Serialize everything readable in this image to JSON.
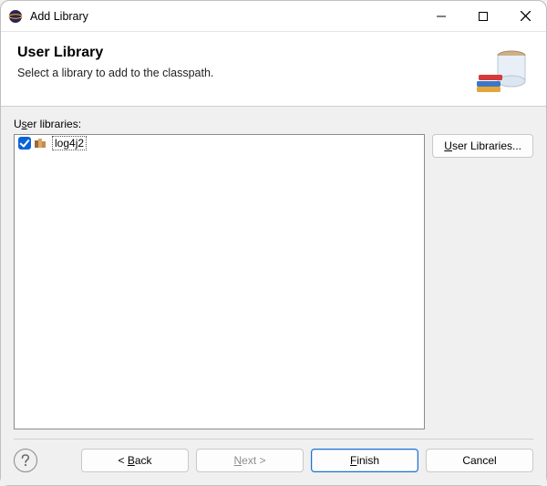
{
  "window": {
    "title": "Add Library"
  },
  "header": {
    "title": "User Library",
    "description": "Select a library to add to the classpath."
  },
  "content": {
    "list_label_pre": "U",
    "list_label_mn": "s",
    "list_label_post": "er libraries:",
    "items": [
      {
        "name": "log4j2",
        "checked": true
      }
    ],
    "side_button_mn": "U",
    "side_button_post": "ser Libraries..."
  },
  "footer": {
    "help_tooltip": "Help",
    "back_pre": "< ",
    "back_mn": "B",
    "back_post": "ack",
    "next_mn": "N",
    "next_post": "ext >",
    "finish_mn": "F",
    "finish_post": "inish",
    "cancel": "Cancel"
  }
}
